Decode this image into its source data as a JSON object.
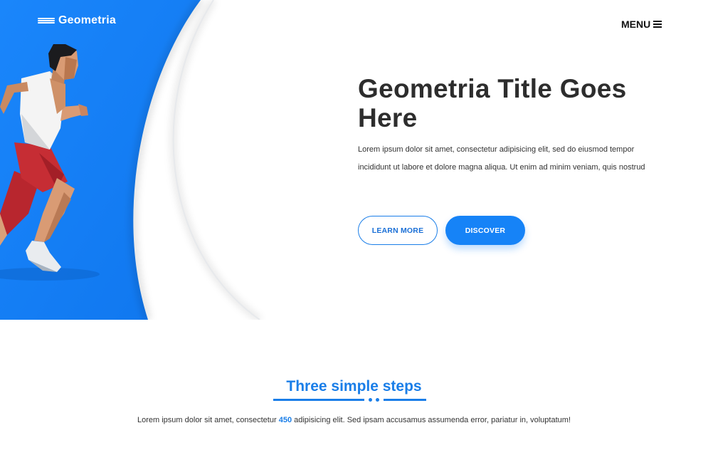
{
  "brand": {
    "name": "Geometria"
  },
  "nav": {
    "menu_label": "MENU"
  },
  "hero": {
    "title": "Geometria Title Goes Here",
    "text": "Lorem ipsum dolor sit amet, consectetur adipisicing elit, sed do eiusmod tempor incididunt ut labore et dolore magna aliqua. Ut enim ad minim veniam, quis nostrud",
    "learn_more_label": "LEARN MORE",
    "discover_label": "DISCOVER"
  },
  "steps": {
    "title": "Three simple steps",
    "text_before": "Lorem ipsum dolor sit amet, consectetur ",
    "highlight": "450",
    "text_after": " adipisicing elit. Sed ipsam accusamus assumenda error, pariatur in, voluptatum!"
  },
  "colors": {
    "accent": "#1683f7",
    "title_dark": "#2d2d2d"
  },
  "icons": [
    "logo-lines-icon",
    "hamburger-icon"
  ]
}
